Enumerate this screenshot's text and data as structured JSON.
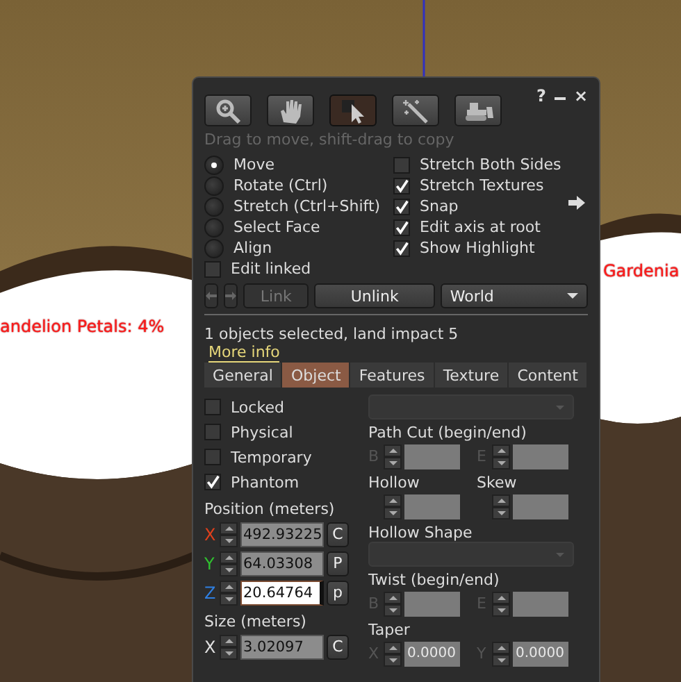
{
  "scene": {
    "labels": [
      {
        "text": "andelion Petals: 4%"
      },
      {
        "text": "Gardenia"
      }
    ]
  },
  "floater": {
    "title_buttons": [
      {
        "kind": "help",
        "text": "?"
      },
      {
        "kind": "minimize"
      },
      {
        "kind": "close",
        "text": "×"
      }
    ],
    "tools": [
      {
        "kind": "magnifier",
        "selected": false
      },
      {
        "kind": "hand",
        "selected": false
      },
      {
        "kind": "pointer",
        "selected": true
      },
      {
        "kind": "wand",
        "selected": false
      },
      {
        "kind": "bulldozer",
        "selected": false
      }
    ],
    "hint": "Drag to move, shift-drag to copy",
    "modes": [
      {
        "label": "Move",
        "selected": true
      },
      {
        "label": "Rotate (Ctrl)",
        "selected": false
      },
      {
        "label": "Stretch (Ctrl+Shift)",
        "selected": false
      },
      {
        "label": "Select Face",
        "selected": false
      },
      {
        "label": "Align",
        "selected": false
      }
    ],
    "edit_linked": {
      "label": "Edit linked",
      "checked": false
    },
    "options": [
      {
        "label": "Stretch Both Sides",
        "checked": false
      },
      {
        "label": "Stretch Textures",
        "checked": true
      },
      {
        "label": "Snap",
        "checked": true
      },
      {
        "label": "Edit axis at root",
        "checked": true
      },
      {
        "label": "Show Highlight",
        "checked": true
      }
    ],
    "link_button": {
      "label": "Link",
      "disabled": true
    },
    "unlink_button": {
      "label": "Unlink",
      "disabled": false
    },
    "reference_dropdown": {
      "value": "World"
    },
    "selection_info": "1 objects selected, land impact 5",
    "more_info": "More info",
    "tabs": [
      {
        "label": "General",
        "selected": false
      },
      {
        "label": "Object",
        "selected": true
      },
      {
        "label": "Features",
        "selected": false
      },
      {
        "label": "Texture",
        "selected": false
      },
      {
        "label": "Content",
        "selected": false
      }
    ],
    "flags": [
      {
        "label": "Locked",
        "checked": false
      },
      {
        "label": "Physical",
        "checked": false
      },
      {
        "label": "Temporary",
        "checked": false
      },
      {
        "label": "Phantom",
        "checked": true
      }
    ],
    "position": {
      "label": "Position (meters)",
      "axes": [
        {
          "axis": "X",
          "color": "#e0401c",
          "value": "492.93225",
          "button": "C",
          "focused": false
        },
        {
          "axis": "Y",
          "color": "#30c030",
          "value": "64.03308",
          "button": "P",
          "focused": false
        },
        {
          "axis": "Z",
          "color": "#2f7fe0",
          "value": "20.64764",
          "button": "p",
          "focused": true
        }
      ]
    },
    "size": {
      "label": "Size (meters)",
      "axes": [
        {
          "axis": "X",
          "color": "#e0e0e0",
          "value": "3.02097",
          "button": "C",
          "focused": false
        }
      ]
    },
    "shape": [
      {
        "kind": "dropdown",
        "disabled": true
      },
      {
        "kind": "heading",
        "text": "Path Cut (begin/end)"
      },
      {
        "kind": "fields",
        "fields": [
          {
            "letter": "B",
            "disabled": true
          },
          {
            "letter": "E",
            "disabled": true
          }
        ]
      },
      {
        "kind": "headings",
        "texts": [
          "Hollow",
          "Skew"
        ]
      },
      {
        "kind": "fields",
        "fields": [
          {
            "disabled": true
          },
          {
            "disabled": true
          }
        ]
      },
      {
        "kind": "heading",
        "text": "Hollow Shape"
      },
      {
        "kind": "dropdown",
        "disabled": true
      },
      {
        "kind": "heading",
        "text": "Twist (begin/end)"
      },
      {
        "kind": "fields",
        "fields": [
          {
            "letter": "B",
            "disabled": true
          },
          {
            "letter": "E",
            "disabled": true
          }
        ]
      },
      {
        "kind": "heading",
        "text": "Taper"
      },
      {
        "kind": "fields",
        "fields": [
          {
            "letter": "X",
            "value": "0.0000",
            "disabled": true
          },
          {
            "letter": "Y",
            "value": "0.0000",
            "disabled": true
          }
        ]
      }
    ]
  }
}
